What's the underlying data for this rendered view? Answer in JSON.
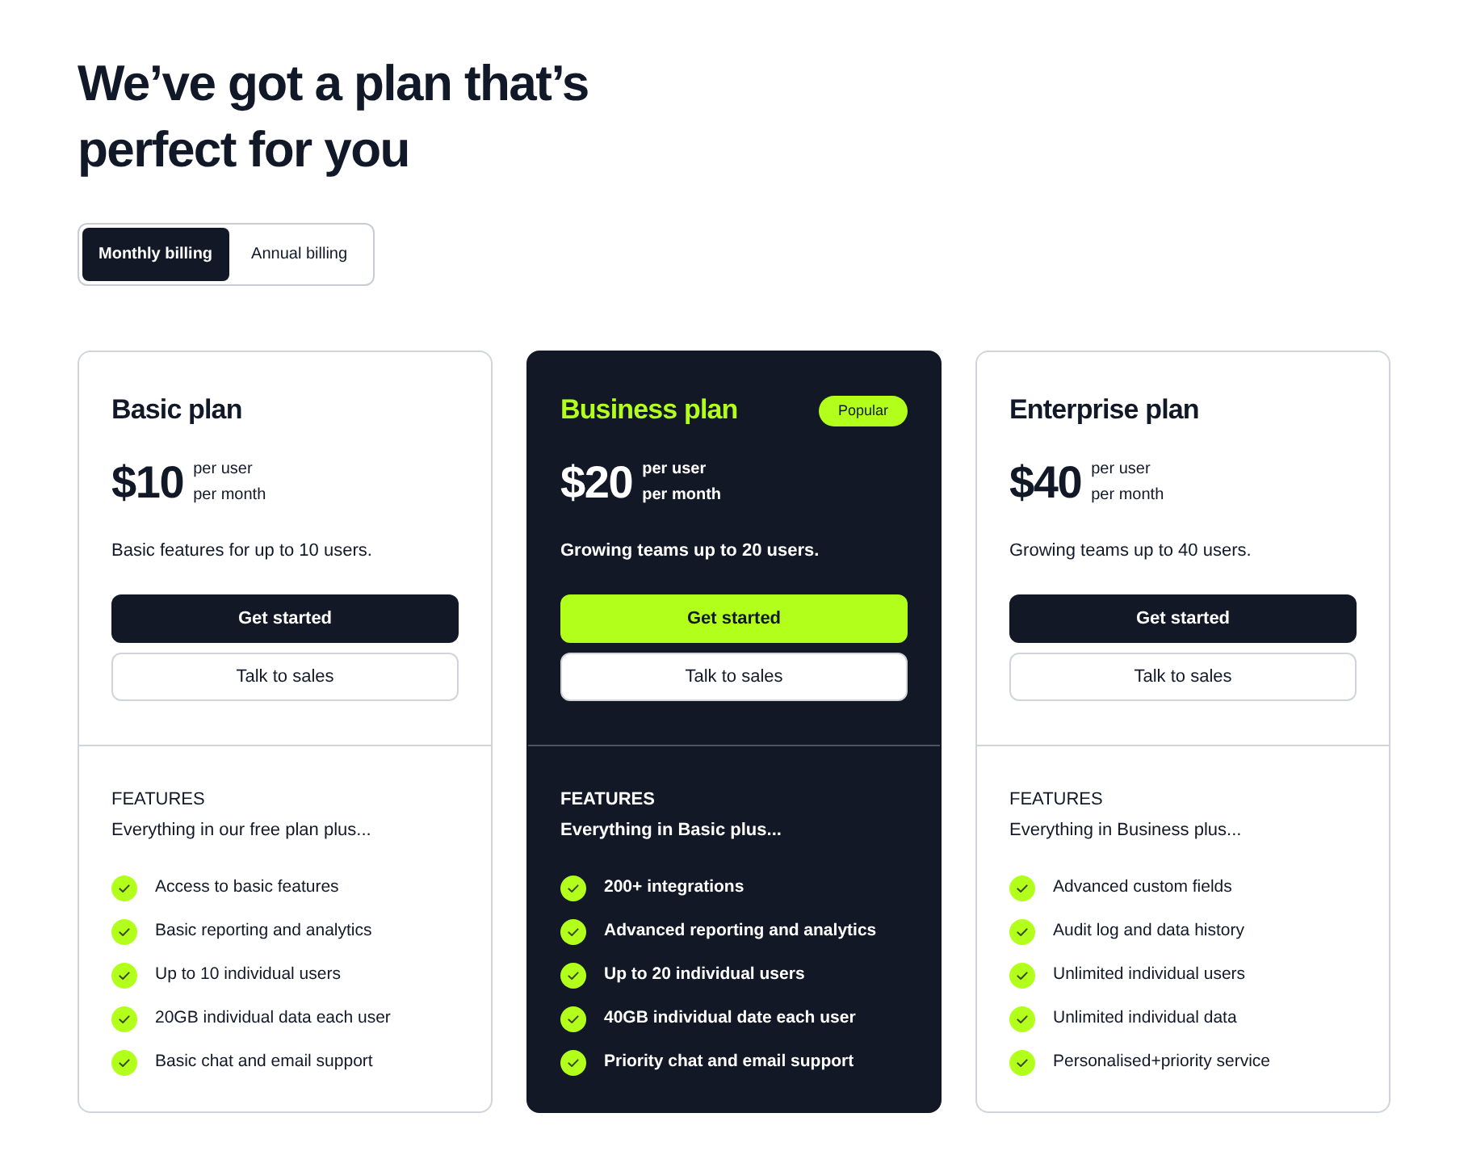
{
  "heading": "We’ve got a plan that’s perfect for you",
  "billing_toggle": [
    {
      "label": "Monthly billing",
      "selected": true
    },
    {
      "label": "Annual billing",
      "selected": false
    }
  ],
  "plans": [
    {
      "name": "Basic plan",
      "featured": false,
      "price": "$10",
      "price_unit": [
        "per user",
        "per month"
      ],
      "description": "Basic features for up to 10 users.",
      "buttons": [
        "Get started",
        "Talk to sales"
      ],
      "features_label": "FEATURES",
      "features_intro": "Everything in our free plan plus...",
      "features": [
        "Access to basic features",
        "Basic reporting and analytics",
        "Up to 10 individual users",
        "20GB individual data each user",
        "Basic chat and email support"
      ]
    },
    {
      "name": "Business plan",
      "featured": true,
      "badge": "Popular",
      "price": "$20",
      "price_unit": [
        "per user",
        "per month"
      ],
      "description": "Growing teams up to 20 users.",
      "buttons": [
        "Get started",
        "Talk to sales"
      ],
      "features_label": "FEATURES",
      "features_intro": "Everything in Basic plus...",
      "features": [
        "200+ integrations",
        "Advanced reporting and analytics",
        "Up to 20 individual users",
        "40GB individual date each user",
        "Priority chat and email support"
      ]
    },
    {
      "name": "Enterprise plan",
      "featured": false,
      "price": "$40",
      "price_unit": [
        "per user",
        "per month"
      ],
      "description": "Growing teams up to 40 users.",
      "buttons": [
        "Get started",
        "Talk to sales"
      ],
      "features_label": "FEATURES",
      "features_intro": "Everything in Business plus...",
      "features": [
        "Advanced custom fields",
        "Audit log and data history",
        "Unlimited individual users",
        "Unlimited individual data",
        "Personalised+priority service"
      ]
    }
  ]
}
